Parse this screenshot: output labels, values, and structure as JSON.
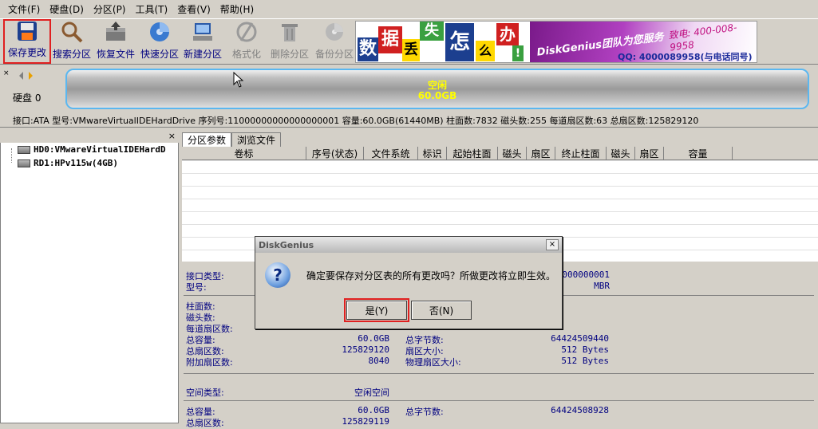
{
  "menu": [
    "文件(F)",
    "硬盘(D)",
    "分区(P)",
    "工具(T)",
    "查看(V)",
    "帮助(H)"
  ],
  "toolbar": [
    {
      "label": "保存更改",
      "icon": "save-icon"
    },
    {
      "label": "搜索分区",
      "icon": "search-icon"
    },
    {
      "label": "恢复文件",
      "icon": "recover-icon"
    },
    {
      "label": "快速分区",
      "icon": "quick-partition-icon"
    },
    {
      "label": "新建分区",
      "icon": "new-partition-icon"
    },
    {
      "label": "格式化",
      "icon": "format-icon"
    },
    {
      "label": "删除分区",
      "icon": "delete-partition-icon"
    },
    {
      "label": "备份分区",
      "icon": "backup-partition-icon"
    }
  ],
  "banner": {
    "chars": [
      "数",
      "据",
      "丢",
      "失",
      "怎",
      "么",
      "办",
      "!"
    ],
    "slogan": "DiskGenius团队为您服务",
    "phone": "致电: 400-008-9958",
    "qq": "QQ: 4000089958(与电话同号)"
  },
  "diskmap": {
    "disk_label": "硬盘 0",
    "partition_name": "空闲",
    "partition_size": "60.0GB"
  },
  "infoline": "接口:ATA  型号:VMwareVirtualIDEHardDrive  序列号:11000000000000000001  容量:60.0GB(61440MB)  柱面数:7832  磁头数:255  每道扇区数:63  总扇区数:125829120",
  "tree": {
    "items": [
      "HD0:VMwareVirtualIDEHardD",
      "RD1:HPv115w(4GB)"
    ]
  },
  "tabs": [
    "分区参数",
    "浏览文件"
  ],
  "table": {
    "columns": [
      "卷标",
      "序号(状态)",
      "文件系统",
      "标识",
      "起始柱面",
      "磁头",
      "扇区",
      "终止柱面",
      "磁头",
      "扇区",
      "容量"
    ]
  },
  "detail": {
    "iface_type_label": "接口类型:",
    "model_label": "型号:",
    "serial_value": "0000000001",
    "model_value": "MBR",
    "cylinders_label": "柱面数:",
    "heads_label": "磁头数:",
    "spt_label": "每道扇区数:",
    "total_cap_label": "总容量:",
    "total_cap_value": "60.0GB",
    "total_bytes_label": "总字节数:",
    "total_bytes_value": "64424509440",
    "total_sectors_label": "总扇区数:",
    "total_sectors_value": "125829120",
    "sector_size_label": "扇区大小:",
    "sector_size_value": "512 Bytes",
    "extra_sectors_label": "附加扇区数:",
    "extra_sectors_value": "8040",
    "phys_sector_label": "物理扇区大小:",
    "phys_sector_value": "512 Bytes",
    "space_type_label": "空间类型:",
    "space_type_value": "空闲空间",
    "free_cap_label": "总容量:",
    "free_cap_value": "60.0GB",
    "free_bytes_label": "总字节数:",
    "free_bytes_value": "64424508928",
    "free_sectors_label": "总扇区数:",
    "free_sectors_value": "125829119"
  },
  "dialog": {
    "title": "DiskGenius",
    "close": "×",
    "message": "确定要保存对分区表的所有更改吗？所做更改将立即生效。",
    "yes": "是(Y)",
    "no": "否(N)"
  }
}
